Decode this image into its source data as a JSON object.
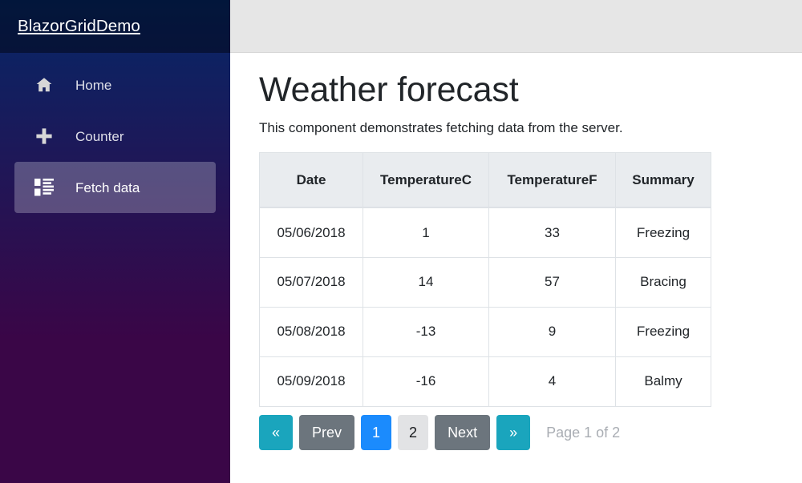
{
  "brand": {
    "title": "BlazorGridDemo"
  },
  "sidebar": {
    "items": [
      {
        "label": "Home",
        "icon": "home-icon",
        "active": false
      },
      {
        "label": "Counter",
        "icon": "plus-icon",
        "active": false
      },
      {
        "label": "Fetch data",
        "icon": "list-rich-icon",
        "active": true
      }
    ]
  },
  "topbar": {},
  "main": {
    "title": "Weather forecast",
    "subtitle": "This component demonstrates fetching data from the server."
  },
  "table": {
    "columns": [
      "Date",
      "TemperatureC",
      "TemperatureF",
      "Summary"
    ],
    "rows": [
      [
        "05/06/2018",
        "1",
        "33",
        "Freezing"
      ],
      [
        "05/07/2018",
        "14",
        "57",
        "Bracing"
      ],
      [
        "05/08/2018",
        "-13",
        "9",
        "Freezing"
      ],
      [
        "05/09/2018",
        "-16",
        "4",
        "Balmy"
      ]
    ]
  },
  "pager": {
    "first_label": "«",
    "prev_label": "Prev",
    "pages": [
      {
        "label": "1",
        "active": true
      },
      {
        "label": "2",
        "active": false
      }
    ],
    "next_label": "Next",
    "last_label": "»",
    "status": "Page 1 of 2"
  },
  "colors": {
    "sidebar_gradient_start": "#052767",
    "sidebar_gradient_end": "#3a0647",
    "topbar_bg": "#e6e6e6",
    "pager_info": "#1aa5bd",
    "pager_secondary": "#6c757d",
    "pager_active": "#1b8bfd",
    "pager_light": "#e2e3e5",
    "table_header_bg": "#e9ecef",
    "table_border": "#dee2e6",
    "status_text": "#a9adb3"
  }
}
